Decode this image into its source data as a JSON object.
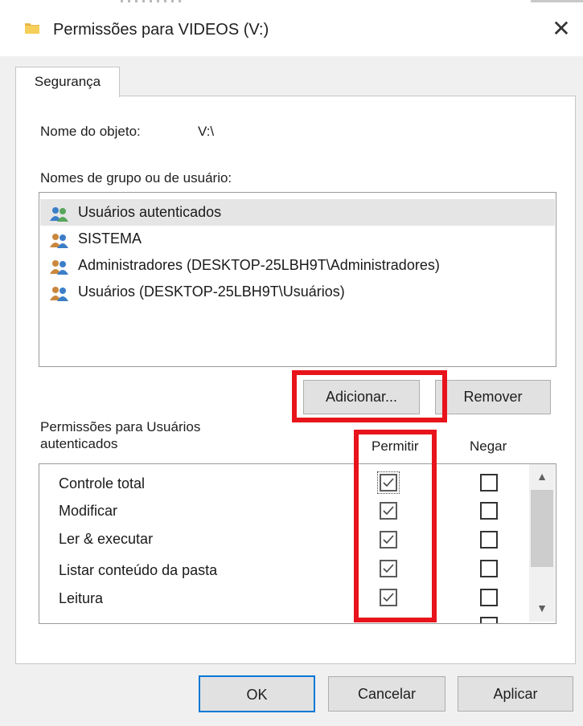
{
  "window": {
    "title": "Permissões para VIDEOS (V:)",
    "close_glyph": "✕",
    "folder_icon": "folder-icon"
  },
  "tabs": [
    {
      "label": "Segurança",
      "active": true
    }
  ],
  "object_name": {
    "label": "Nome do objeto:",
    "value": "V:\\"
  },
  "groups": {
    "label": "Nomes de grupo ou de usuário:",
    "items": [
      {
        "label": "Usuários autenticados",
        "selected": true,
        "icon": "users-group-icon"
      },
      {
        "label": "SISTEMA",
        "selected": false,
        "icon": "users-group-icon"
      },
      {
        "label": "Administradores (DESKTOP-25LBH9T\\Administradores)",
        "selected": false,
        "icon": "users-group-icon"
      },
      {
        "label": "Usuários (DESKTOP-25LBH9T\\Usuários)",
        "selected": false,
        "icon": "users-group-icon"
      }
    ]
  },
  "group_buttons": {
    "add": "Adicionar...",
    "remove": "Remover"
  },
  "permissions": {
    "label_line1": "Permissões para Usuários",
    "label_line2": "autenticados",
    "col_allow": "Permitir",
    "col_deny": "Negar",
    "rows": [
      {
        "label": "Controle total",
        "allow": true,
        "deny": false
      },
      {
        "label": "Modificar",
        "allow": true,
        "deny": false
      },
      {
        "label": "Ler & executar",
        "allow": true,
        "deny": false
      },
      {
        "label": "Listar conteúdo da pasta",
        "allow": true,
        "deny": false
      },
      {
        "label": "Leitura",
        "allow": true,
        "deny": false
      }
    ]
  },
  "footer": {
    "ok": "OK",
    "cancel": "Cancelar",
    "apply": "Aplicar"
  },
  "colors": {
    "highlight": "#e8141b",
    "focus_border": "#0078d7",
    "selected_row": "#e5e5e5"
  }
}
